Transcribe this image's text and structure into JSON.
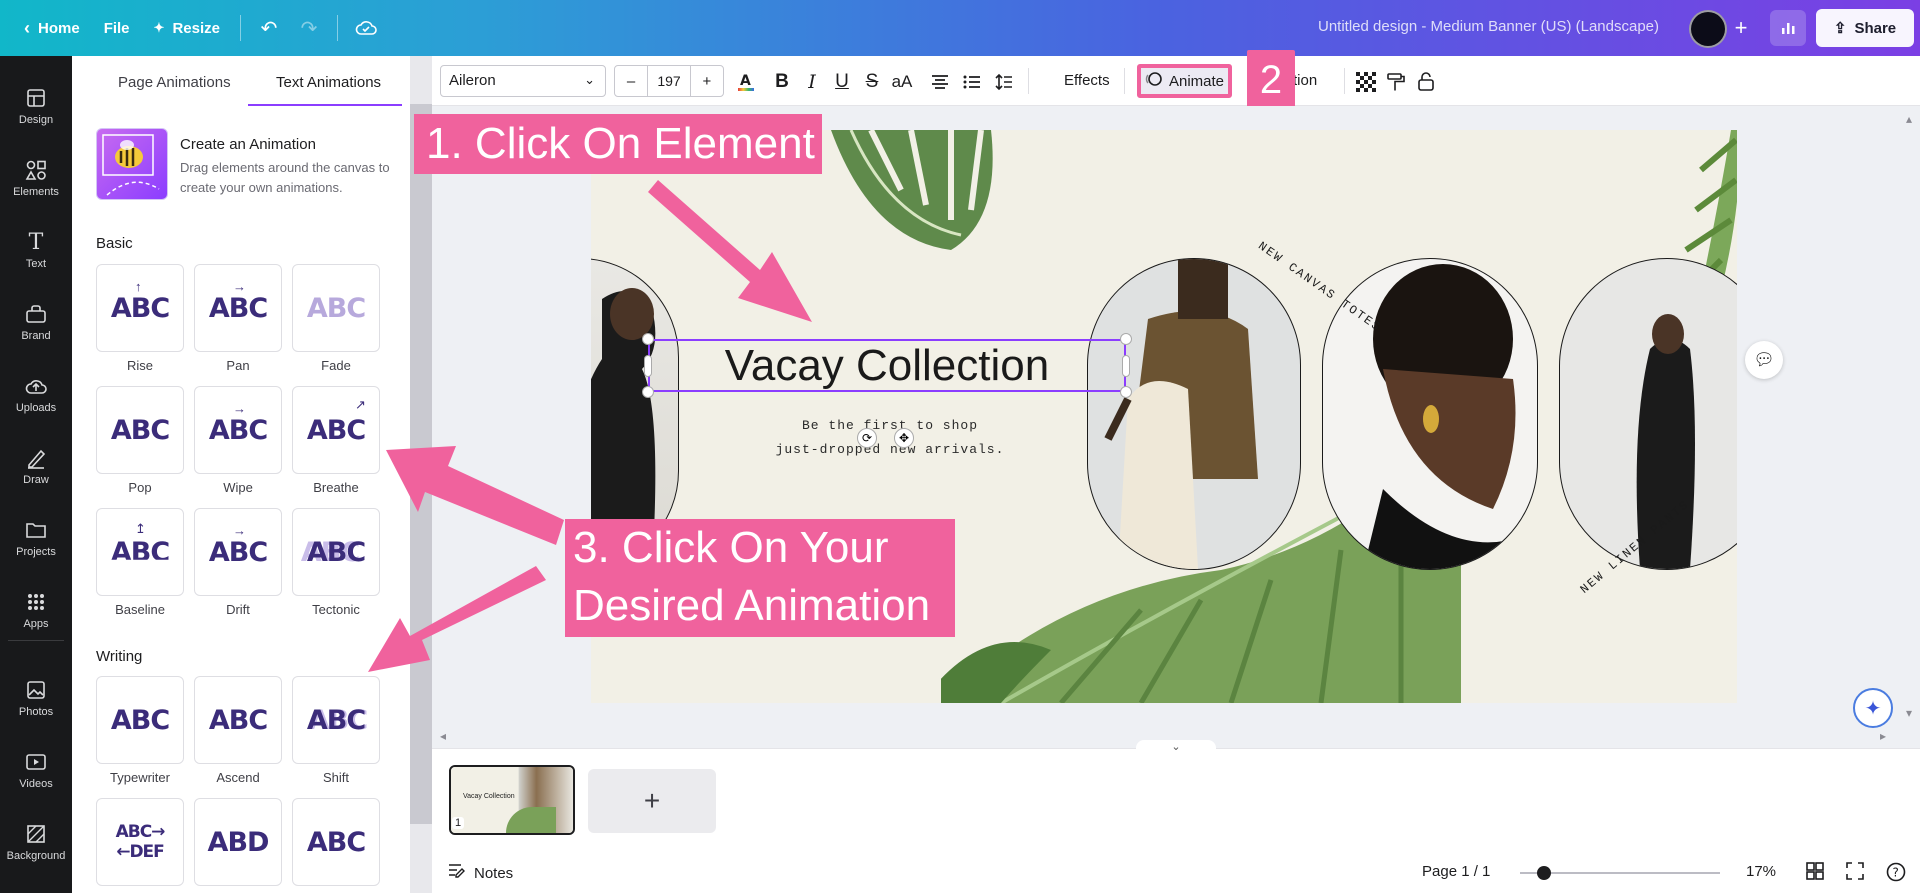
{
  "topbar": {
    "home_label": "Home",
    "file_label": "File",
    "resize_label": "Resize",
    "title": "Untitled design - Medium Banner (US) (Landscape)",
    "share_label": "Share",
    "avatar_color": "#0c0c18"
  },
  "rail": {
    "items": [
      {
        "label": "Design",
        "icon": "design-icon"
      },
      {
        "label": "Elements",
        "icon": "elements-icon"
      },
      {
        "label": "Text",
        "icon": "text-icon"
      },
      {
        "label": "Brand",
        "icon": "brand-icon"
      },
      {
        "label": "Uploads",
        "icon": "uploads-icon"
      },
      {
        "label": "Draw",
        "icon": "draw-icon"
      },
      {
        "label": "Projects",
        "icon": "projects-icon"
      },
      {
        "label": "Apps",
        "icon": "apps-icon"
      },
      {
        "label": "Photos",
        "icon": "photos-icon"
      },
      {
        "label": "Videos",
        "icon": "videos-icon"
      },
      {
        "label": "Background",
        "icon": "background-icon"
      }
    ]
  },
  "panel": {
    "tabs": {
      "page": "Page Animations",
      "text": "Text Animations"
    },
    "create": {
      "title": "Create an Animation",
      "desc": "Drag elements around the canvas to create your own animations."
    },
    "basic_label": "Basic",
    "writing_label": "Writing",
    "basic": [
      {
        "name": "Rise",
        "glyph": "ABC",
        "arrow": "↑"
      },
      {
        "name": "Pan",
        "glyph": "ABC",
        "arrow": "→"
      },
      {
        "name": "Fade",
        "glyph": "ABC",
        "arrow": ""
      },
      {
        "name": "Pop",
        "glyph": "ABC",
        "arrow": ""
      },
      {
        "name": "Wipe",
        "glyph": "ABC",
        "arrow": "→"
      },
      {
        "name": "Breathe",
        "glyph": "ABC",
        "arrow": "↗"
      },
      {
        "name": "Baseline",
        "glyph": "ABC",
        "arrow": "↥"
      },
      {
        "name": "Drift",
        "glyph": "ABC",
        "arrow": "→"
      },
      {
        "name": "Tectonic",
        "glyph": "ABC",
        "arrow": ""
      }
    ],
    "writing": [
      {
        "name": "Typewriter",
        "glyph": "ABC"
      },
      {
        "name": "Ascend",
        "glyph": "ABC"
      },
      {
        "name": "Shift",
        "glyph": "ABC"
      },
      {
        "name": "",
        "glyph": "ABC→ ←DEF"
      },
      {
        "name": "",
        "glyph": "ABD"
      },
      {
        "name": "",
        "glyph": "ABC"
      }
    ]
  },
  "toolbar": {
    "font": "Aileron",
    "font_size": "197",
    "minus": "–",
    "plus": "+",
    "effects_label": "Effects",
    "animate_label": "Animate",
    "position_label": "tion"
  },
  "design": {
    "title": "Vacay Collection",
    "subtitle_line1": "Be the first to shop",
    "subtitle_line2": "just-dropped new arrivals.",
    "curved_1": "NEW CANVAS TOTES",
    "curved_2": "NEW LINEN PANTS",
    "bg_color": "#f2f0e6"
  },
  "footer": {
    "notes_label": "Notes",
    "page_count": "Page 1 / 1",
    "zoom": "17%",
    "page_number": "1"
  },
  "annotations": {
    "step1": "1. Click On Element",
    "step2": "2",
    "step3_line1": "3. Click On Your",
    "step3_line2": "Desired Animation",
    "accent": "#f0629d"
  }
}
